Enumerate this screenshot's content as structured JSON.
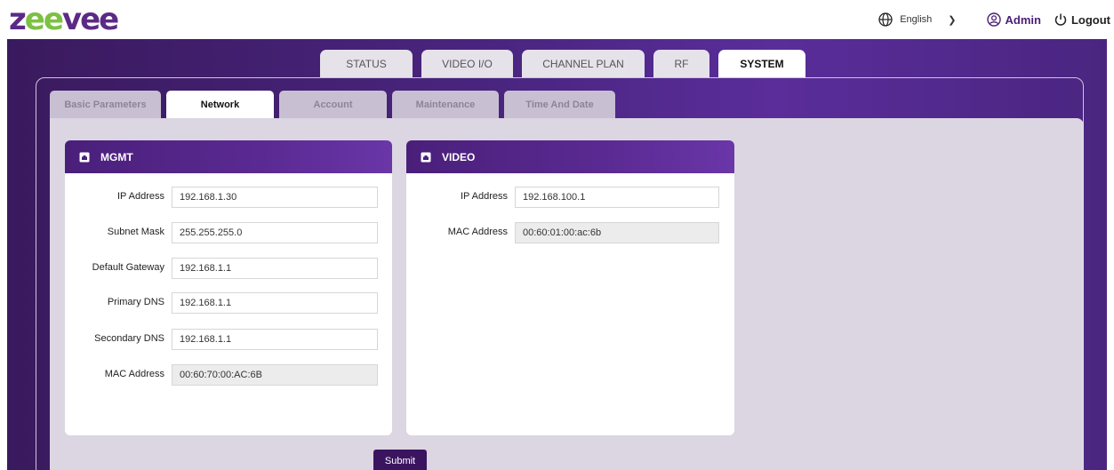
{
  "header": {
    "logo_prefix": "z",
    "logo_middle": "ee",
    "logo_suffix": "vee",
    "language": "English",
    "user": "Admin",
    "logout": "Logout"
  },
  "main_tabs": [
    {
      "label": "STATUS",
      "active": false
    },
    {
      "label": "VIDEO I/O",
      "active": false
    },
    {
      "label": "CHANNEL PLAN",
      "active": false
    },
    {
      "label": "RF",
      "active": false
    },
    {
      "label": "SYSTEM",
      "active": true
    }
  ],
  "sub_tabs": [
    {
      "label": "Basic Parameters",
      "active": false
    },
    {
      "label": "Network",
      "active": true
    },
    {
      "label": "Account",
      "active": false
    },
    {
      "label": "Maintenance",
      "active": false
    },
    {
      "label": "Time And Date",
      "active": false
    }
  ],
  "mgmt": {
    "title": "MGMT",
    "fields": [
      {
        "label": "IP Address",
        "value": "192.168.1.30",
        "readonly": false
      },
      {
        "label": "Subnet Mask",
        "value": "255.255.255.0",
        "readonly": false
      },
      {
        "label": "Default Gateway",
        "value": "192.168.1.1",
        "readonly": false
      },
      {
        "label": "Primary DNS",
        "value": "192.168.1.1",
        "readonly": false
      },
      {
        "label": "Secondary DNS",
        "value": "192.168.1.1",
        "readonly": false
      },
      {
        "label": "MAC Address",
        "value": "00:60:70:00:AC:6B",
        "readonly": true
      }
    ]
  },
  "video": {
    "title": "VIDEO",
    "fields": [
      {
        "label": "IP Address",
        "value": "192.168.100.1",
        "readonly": false
      },
      {
        "label": "MAC Address",
        "value": "00:60:01:00:ac:6b",
        "readonly": true
      }
    ]
  },
  "submit_label": "Submit",
  "colors": {
    "brand_purple": "#4a1f7a",
    "logo_green": "#7bc142",
    "submit": "#3b1460"
  }
}
